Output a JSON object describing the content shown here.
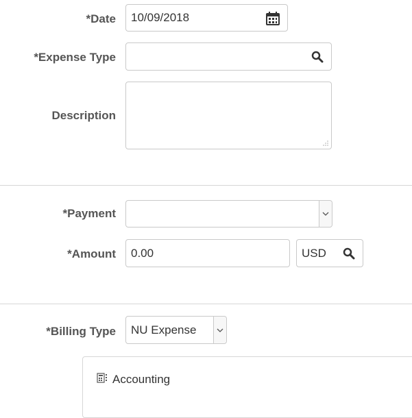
{
  "date": {
    "label": "*Date",
    "value": "10/09/2018",
    "icon": "calendar-icon"
  },
  "expense_type": {
    "label": "*Expense Type",
    "value": "",
    "icon": "search-icon"
  },
  "description": {
    "label": "Description",
    "value": ""
  },
  "payment": {
    "label": "*Payment",
    "value": "",
    "icon": "chevron-down-icon"
  },
  "amount": {
    "label": "*Amount",
    "value": "0.00",
    "currency": "USD",
    "currency_icon": "search-icon"
  },
  "billing_type": {
    "label": "*Billing Type",
    "value": "NU Expense",
    "icon": "chevron-down-icon"
  },
  "accounting": {
    "label": "Accounting",
    "icon": "accounting-icon"
  }
}
